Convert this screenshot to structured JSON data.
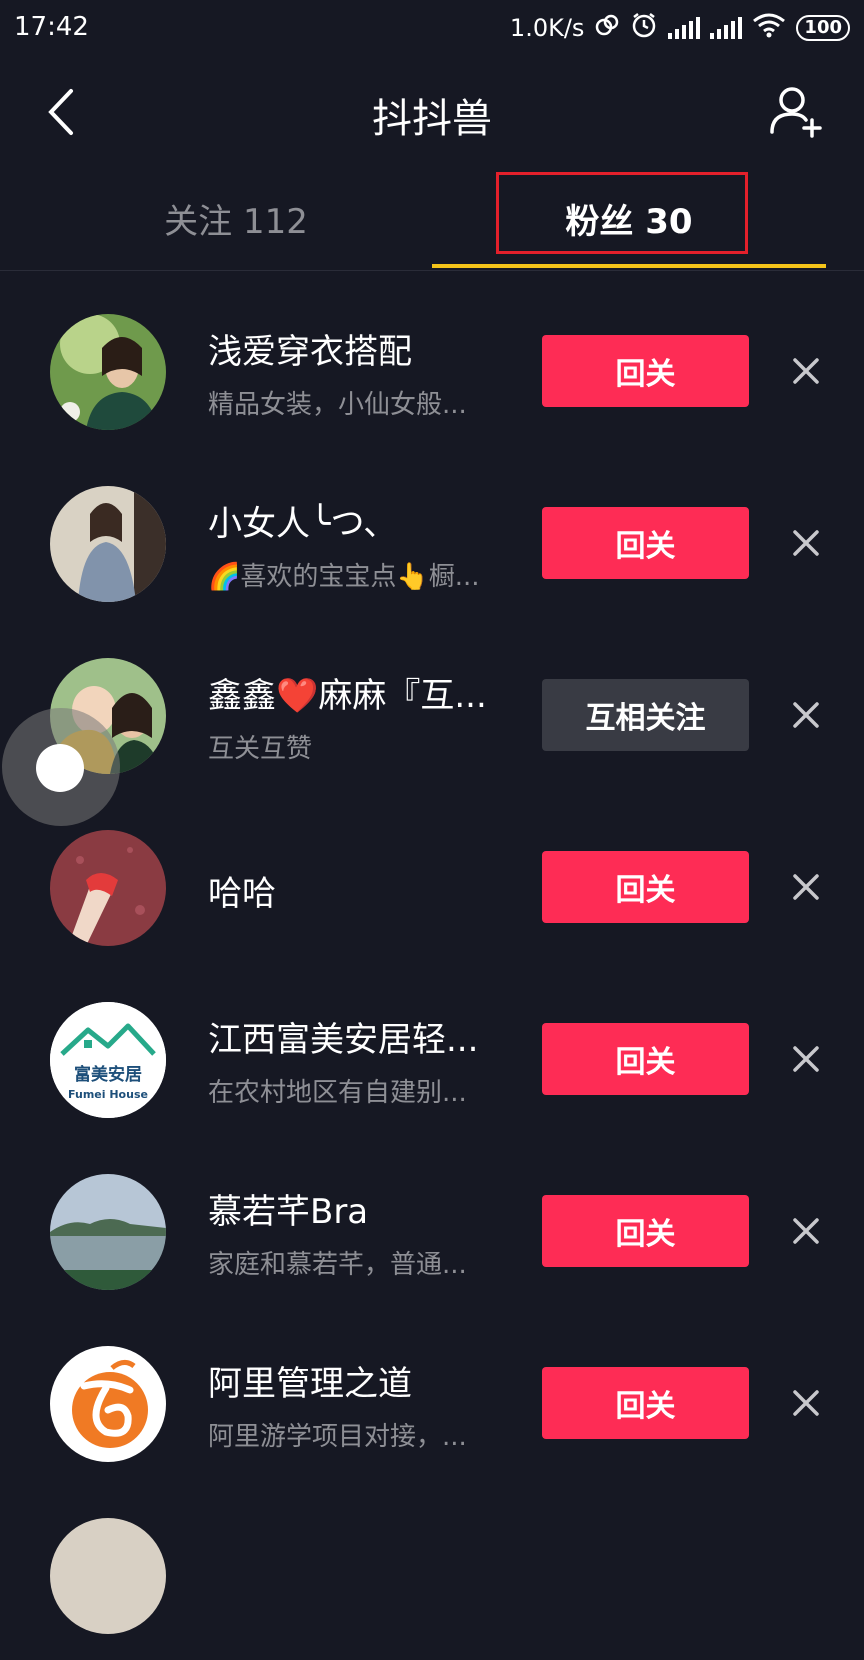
{
  "status": {
    "time": "17:42",
    "speed": "1.0K/s",
    "battery": "100"
  },
  "header": {
    "title": "抖抖兽"
  },
  "tabs": {
    "following": "关注 112",
    "fans": "粉丝 30"
  },
  "colors": {
    "background": "#161823",
    "accent_red": "#fe2c55",
    "tab_indicator": "#f4c41a",
    "highlight_box": "#e3202b"
  },
  "fans": [
    {
      "name": "浅爱穿衣搭配",
      "desc": "精品女装，小仙女般...",
      "button": "回关",
      "avatar_icon": "avatar-photo"
    },
    {
      "name": "小女人╰つ、",
      "desc": "🌈喜欢的宝宝点👆橱...",
      "button": "回关",
      "avatar_icon": "avatar-photo"
    },
    {
      "name": "鑫鑫❤️麻麻『互...",
      "desc": "互关互赞",
      "button": "互相关注",
      "avatar_icon": "avatar-photo"
    },
    {
      "name": "哈哈",
      "desc": "",
      "button": "回关",
      "avatar_icon": "avatar-photo"
    },
    {
      "name": "江西富美安居轻...",
      "desc": "在农村地区有自建别...",
      "button": "回关",
      "avatar_icon": "logo-fumei-house",
      "logo_text": "富美安居",
      "logo_sub": "Fumei House"
    },
    {
      "name": "慕若芊Bra",
      "desc": "家庭和慕若芊，普通...",
      "button": "回关",
      "avatar_icon": "avatar-landscape"
    },
    {
      "name": "阿里管理之道",
      "desc": "阿里游学项目对接，...",
      "button": "回关",
      "avatar_icon": "logo-orange-swirl"
    }
  ]
}
